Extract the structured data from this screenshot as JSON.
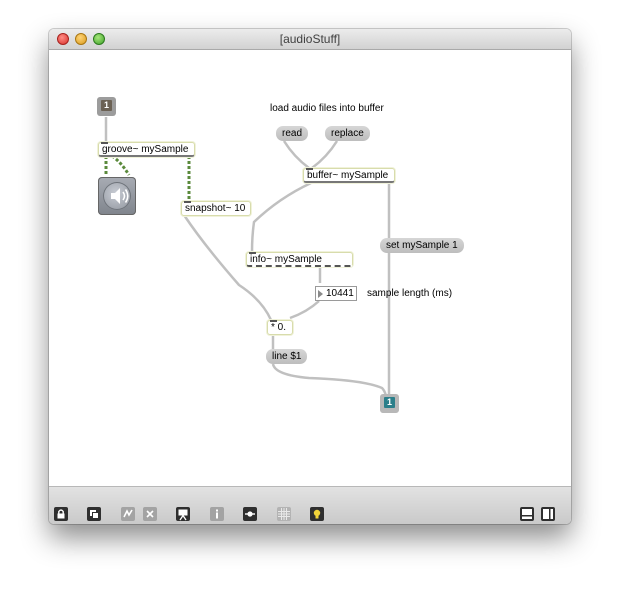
{
  "window": {
    "title": "[audioStuff]"
  },
  "patch": {
    "comment_load": "load audio files into buffer",
    "comment_length": "sample length (ms)",
    "msg_read": "read",
    "msg_replace": "replace",
    "msg_set": "set mySample 1",
    "msg_line": "line $1",
    "obj_groove": "groove~ mySample",
    "obj_snapshot": "snapshot~ 10",
    "obj_buffer": "buffer~ mySample",
    "obj_info": "info~ mySample",
    "obj_mult": "* 0.",
    "number_value": "10441",
    "toggle_top": "1",
    "toggle_bottom": "1"
  },
  "colors": {
    "toggle_top": "#6b6154",
    "toggle_bottom": "#2c7f8a",
    "cord": "#c0c0c0",
    "signal_cord": "#5b8a3c"
  },
  "toolbar": {
    "icons": [
      "lock-icon",
      "new-view-icon",
      "clipboard-icon",
      "close-x-icon",
      "presentation-icon",
      "info-icon",
      "dot-slider-icon",
      "grid-icon",
      "bulb-icon",
      "layout-bottom-icon",
      "layout-right-icon"
    ]
  }
}
